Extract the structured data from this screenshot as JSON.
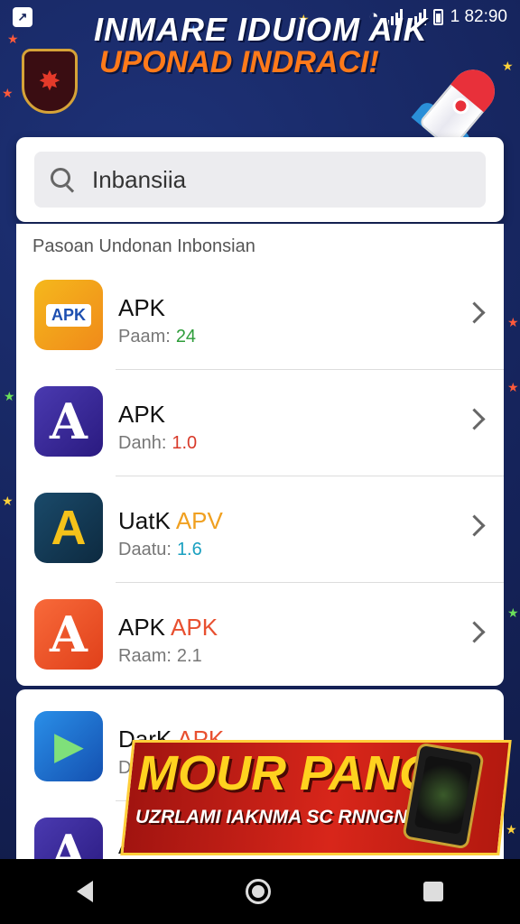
{
  "status_bar": {
    "time": "1 82:90"
  },
  "banner": {
    "title": "INMARE IDUIOM AIK",
    "subtitle": "UPONAD INDRACI!"
  },
  "search": {
    "value": "Inbansiia"
  },
  "section": {
    "header": "Pasoan  Undonan Inbonsian"
  },
  "apps": [
    {
      "name": "APK",
      "accent": "",
      "meta_label": "Paam:",
      "meta_value": "24",
      "meta_color": "#2e9d3a",
      "icon_text": "APK",
      "icon_bg": "#f5b81c",
      "icon_fg": "#1d4fb0"
    },
    {
      "name": "APK",
      "accent": "",
      "meta_label": "Danh:",
      "meta_value": "1.0",
      "meta_color": "#d83a2a",
      "icon_text": "A",
      "icon_bg": "#3a2a98",
      "icon_fg": "#ffffff"
    },
    {
      "name": "UatK",
      "accent": "APV",
      "accent_color": "#f0a020",
      "meta_label": "Daatu:",
      "meta_value": "1.6",
      "meta_color": "#1aa0c0",
      "icon_text": "A",
      "icon_bg": "#1a3a5a",
      "icon_fg": "#f5c21a"
    },
    {
      "name": "APK",
      "accent": "APK",
      "accent_color": "#e85030",
      "meta_label": "Raam:",
      "meta_value": "2.1",
      "meta_color": "#777777",
      "icon_text": "A",
      "icon_bg": "#f05a2a",
      "icon_fg": "#ffffff"
    }
  ],
  "apps_2": [
    {
      "name": "DarK",
      "accent": "APK",
      "accent_color": "#e85030",
      "meta_label": "Da",
      "icon_text": "▶",
      "icon_bg": "#1d6fd8"
    },
    {
      "name": "A",
      "icon_text": "A",
      "icon_bg": "#3a2a98"
    }
  ],
  "promo": {
    "title": "MOUR PANG!",
    "subtitle": "UZRLAMI IAKNMA SC RNNGNIABI!"
  },
  "icons": {
    "back": "back-icon",
    "home": "home-icon",
    "recents": "recents-icon"
  }
}
